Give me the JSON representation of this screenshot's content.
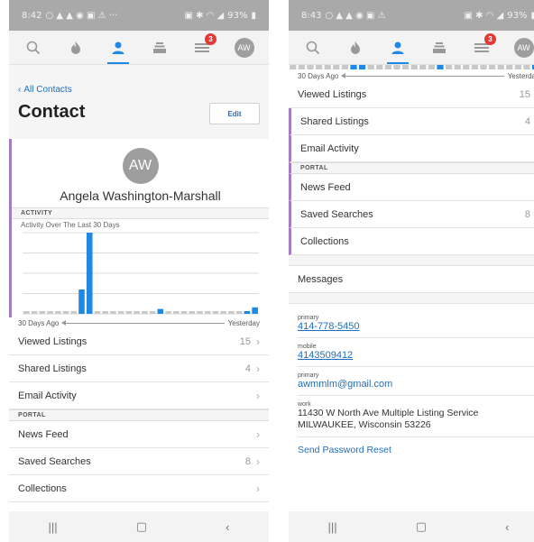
{
  "screens": {
    "left": {
      "status": {
        "time": "8:42",
        "battery": "93%"
      },
      "nav": {
        "badge_count": "3",
        "avatar_initials": "AW"
      },
      "back_label": "All Contacts",
      "title": "Contact",
      "edit_label": "Edit",
      "avatar_initials": "AW",
      "contact_name": "Angela Washington-Marshall",
      "activity_section": "ACTIVITY",
      "chart_title": "Activity Over The Last 30 Days",
      "axis_start": "30 Days Ago",
      "axis_end": "Yesterday",
      "rows": [
        {
          "label": "Viewed Listings",
          "count": "15"
        },
        {
          "label": "Shared Listings",
          "count": "4"
        },
        {
          "label": "Email Activity",
          "count": ""
        }
      ],
      "portal_section": "PORTAL",
      "portal_rows": [
        {
          "label": "News Feed",
          "count": ""
        },
        {
          "label": "Saved Searches",
          "count": "8"
        },
        {
          "label": "Collections",
          "count": ""
        }
      ]
    },
    "right": {
      "status": {
        "time": "8:43",
        "battery": "93%"
      },
      "nav": {
        "badge_count": "3",
        "avatar_initials": "AW"
      },
      "axis_start": "30 Days Ago",
      "axis_end": "Yesterday",
      "rows": [
        {
          "label": "Viewed Listings",
          "count": "15"
        },
        {
          "label": "Shared Listings",
          "count": "4"
        },
        {
          "label": "Email Activity",
          "count": ""
        }
      ],
      "portal_section": "PORTAL",
      "portal_rows": [
        {
          "label": "News Feed",
          "count": ""
        },
        {
          "label": "Saved Searches",
          "count": "8"
        },
        {
          "label": "Collections",
          "count": ""
        }
      ],
      "messages_label": "Messages",
      "contact_info": {
        "phone1_type": "primary",
        "phone1": "414-778-5450",
        "phone2_type": "mobile",
        "phone2": "4143509412",
        "email_type": "primary",
        "email": "awmmlm@gmail.com",
        "address_type": "work",
        "address_line1": "11430 W North Ave Multiple Listing Service",
        "address_line2": "MILWAUKEE, Wisconsin 53226"
      },
      "reset_label": "Send Password Reset"
    }
  },
  "chart_data": {
    "type": "bar",
    "title": "Activity Over The Last 30 Days",
    "xlabel": "",
    "ylabel": "",
    "x_start_label": "30 Days Ago",
    "x_end_label": "Yesterday",
    "values": [
      0,
      0,
      0,
      0,
      0,
      0,
      0,
      0.3,
      1,
      0,
      0,
      0,
      0,
      0,
      0,
      0,
      0,
      0.06,
      0,
      0,
      0,
      0,
      0,
      0,
      0,
      0,
      0,
      0,
      0.03,
      0.08
    ],
    "ylim": [
      0,
      1
    ],
    "grid": true,
    "colors": {
      "bar": "#1e88e5",
      "empty": "#c8c8c8",
      "accent": "#a77bbf",
      "link": "#1e6fbf"
    }
  }
}
